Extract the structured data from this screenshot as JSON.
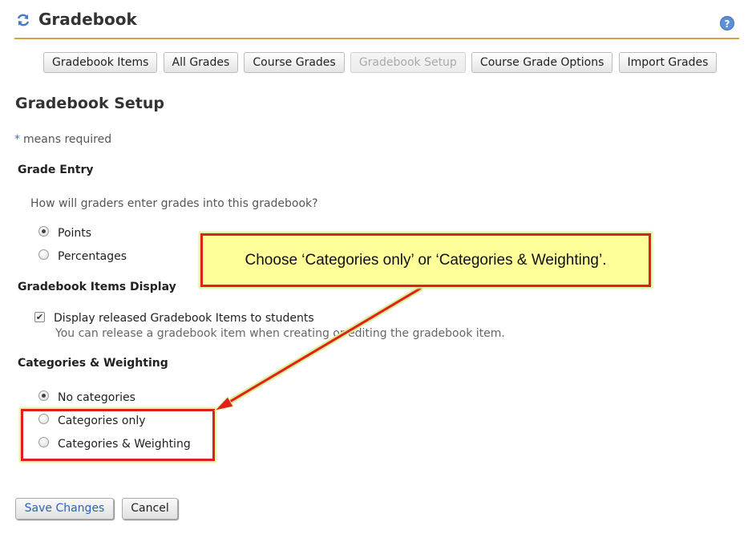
{
  "header": {
    "title": "Gradebook",
    "help_symbol": "?"
  },
  "nav": {
    "buttons": [
      {
        "label": "Gradebook Items",
        "current": false
      },
      {
        "label": "All Grades",
        "current": false
      },
      {
        "label": "Course Grades",
        "current": false
      },
      {
        "label": "Gradebook Setup",
        "current": true
      },
      {
        "label": "Course Grade Options",
        "current": false
      },
      {
        "label": "Import Grades",
        "current": false
      }
    ]
  },
  "page": {
    "title": "Gradebook Setup",
    "required_star": "*",
    "required_note": "means required"
  },
  "grade_entry": {
    "heading": "Grade Entry",
    "question": "How will graders enter grades into this gradebook?",
    "options": [
      {
        "label": "Points",
        "checked": true
      },
      {
        "label": "Percentages",
        "checked": false
      }
    ]
  },
  "items_display": {
    "heading": "Gradebook Items Display",
    "checkbox_label": "Display released Gradebook Items to students",
    "checked": true,
    "help": "You can release a gradebook item when creating or editing the gradebook item."
  },
  "categories": {
    "heading": "Categories & Weighting",
    "options": [
      {
        "label": "No categories",
        "checked": true
      },
      {
        "label": "Categories only",
        "checked": false
      },
      {
        "label": "Categories & Weighting",
        "checked": false
      }
    ]
  },
  "callout": {
    "text": "Choose ‘Categories only’ or ‘Categories & Weighting’."
  },
  "actions": {
    "save": "Save Changes",
    "cancel": "Cancel"
  },
  "colors": {
    "accent_line": "#d9a441",
    "annotation_red": "#e02020",
    "callout_fill": "#ffff99",
    "link_blue": "#2a63b8"
  }
}
